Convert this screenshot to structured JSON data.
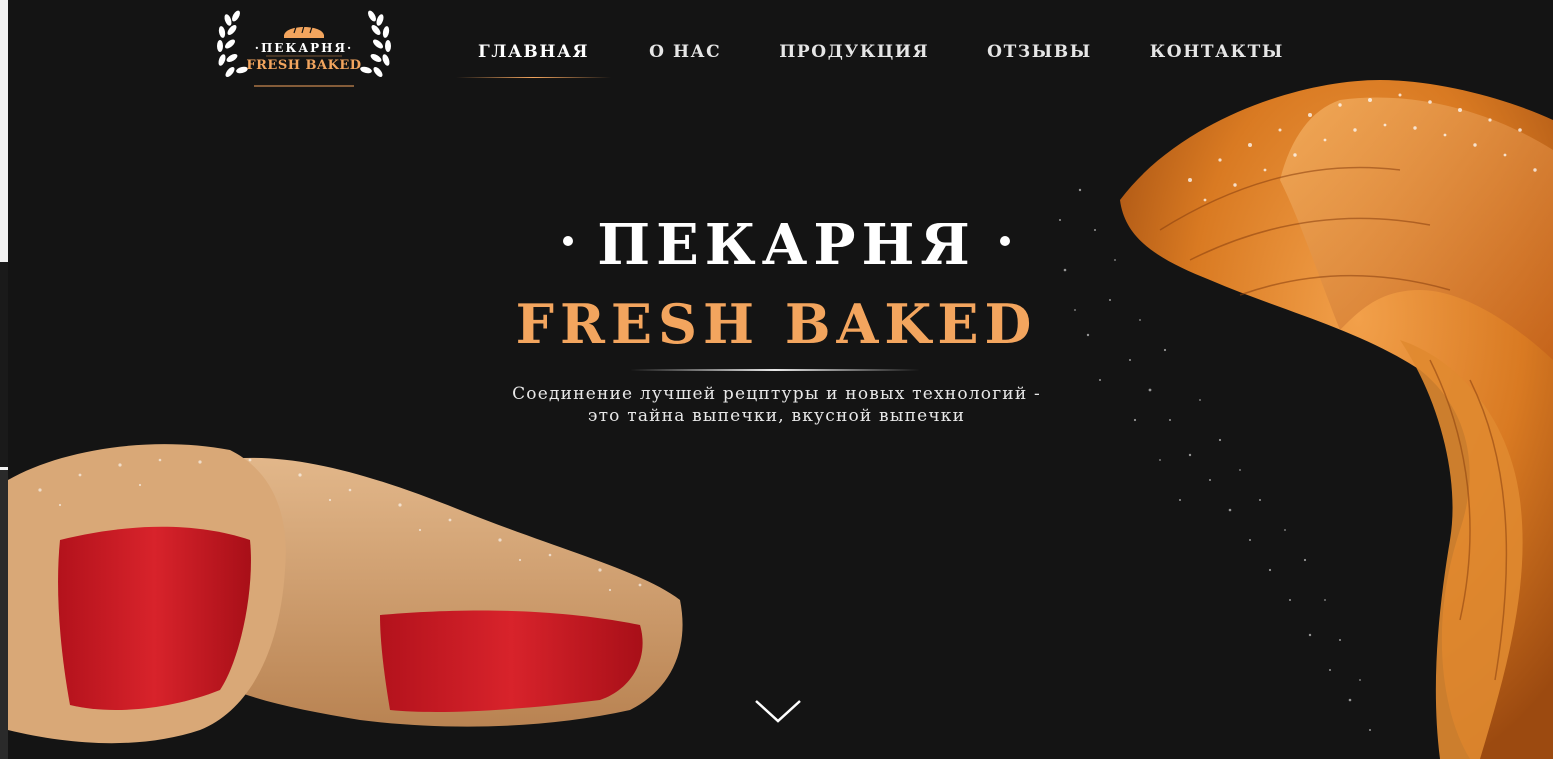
{
  "header": {
    "logo": {
      "top_text": "·ПЕКАРНЯ·",
      "bottom_text": "FRESH BAKED",
      "icon": "bread-icon"
    },
    "nav": [
      {
        "label": "ГЛАВНАЯ",
        "active": true
      },
      {
        "label": "О НАС",
        "active": false
      },
      {
        "label": "ПРОДУКЦИЯ",
        "active": false
      },
      {
        "label": "ОТЗЫВЫ",
        "active": false
      },
      {
        "label": "КОНТАКТЫ",
        "active": false
      }
    ]
  },
  "hero": {
    "title": "ПЕКАРНЯ",
    "brand": "FRESH BAKED",
    "subtitle_line1": "Соединение лучшей рецптуры и новых технологий -",
    "subtitle_line2": "это тайна выпечки, вкусной выпечки",
    "scroll_icon": "chevron-down-icon"
  },
  "colors": {
    "background": "#141414",
    "accent": "#f3a55e",
    "text": "#ffffff"
  }
}
